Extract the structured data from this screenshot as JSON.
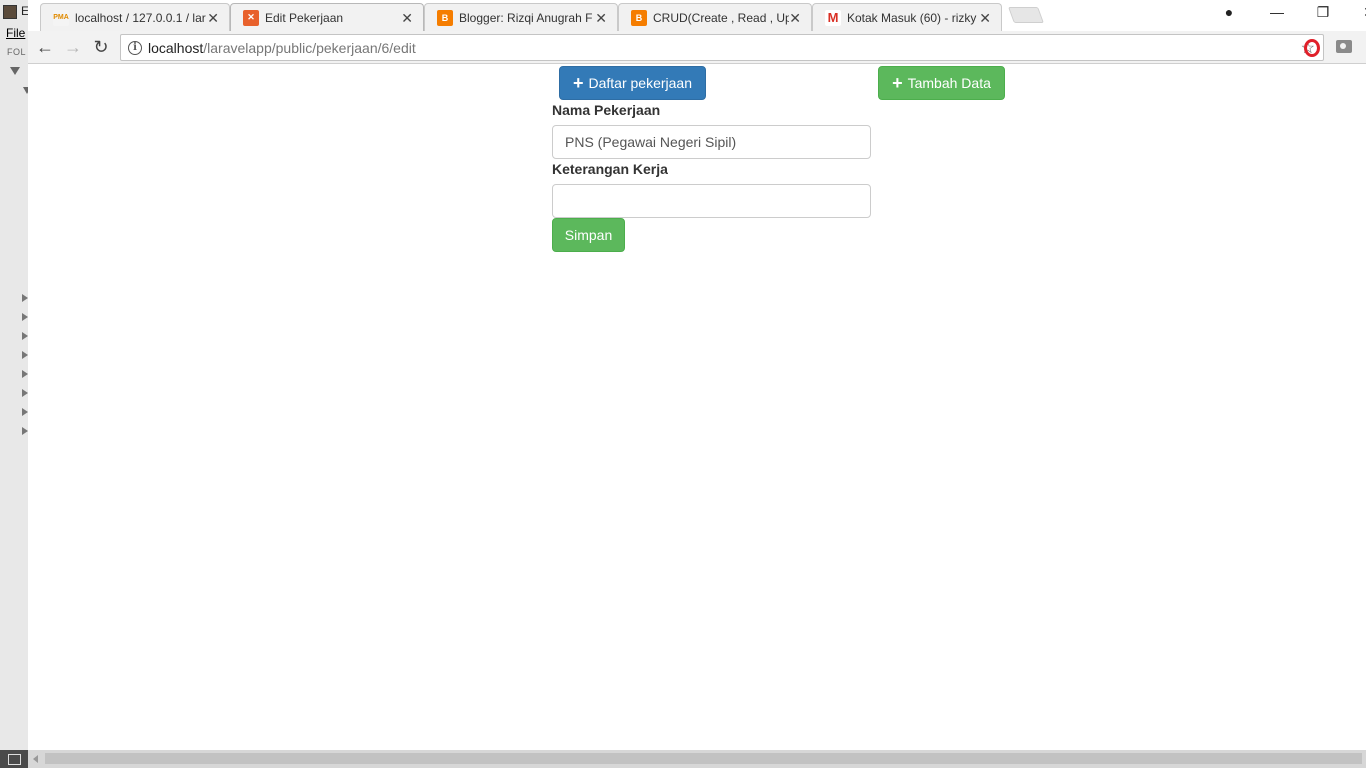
{
  "editor": {
    "title_fragment": "E",
    "menu_file": "File",
    "folders_label": "FOL"
  },
  "tabs": [
    {
      "title": "localhost / 127.0.0.1 / lar",
      "favicon": "phpmyadmin-icon",
      "active": false
    },
    {
      "title": "Edit Pekerjaan",
      "favicon": "laravel-icon",
      "active": true
    },
    {
      "title": "Blogger: Rizqi Anugrah F",
      "favicon": "blogger-icon",
      "active": false
    },
    {
      "title": "CRUD(Create , Read , Up",
      "favicon": "blogger-icon",
      "active": false
    },
    {
      "title": "Kotak Masuk (60) - rizky",
      "favicon": "gmail-icon",
      "active": false
    }
  ],
  "address_bar": {
    "host": "localhost",
    "path": "/laravelapp/public/pekerjaan/6/edit"
  },
  "page": {
    "list_button": "Daftar pekerjaan",
    "add_button": "Tambah Data",
    "name_label": "Nama Pekerjaan",
    "name_value": "PNS (Pegawai Negeri Sipil)",
    "desc_label": "Keterangan Kerja",
    "desc_value": "",
    "save_button": "Simpan"
  },
  "colors": {
    "primary": "#337ab7",
    "success": "#5cb85c",
    "opera_red": "#e0202a"
  }
}
